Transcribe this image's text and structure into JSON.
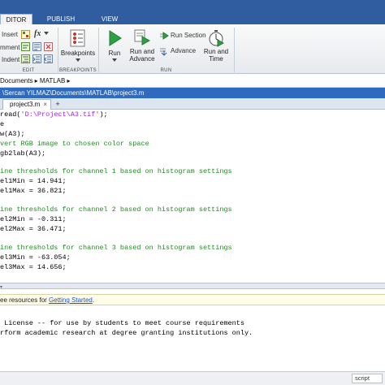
{
  "tabs": [
    {
      "label": "EDITOR",
      "active": true,
      "display": "DITOR"
    },
    {
      "label": "PUBLISH",
      "active": false,
      "display": "PUBLISH"
    },
    {
      "label": "VIEW",
      "active": false,
      "display": "VIEW"
    }
  ],
  "ribbon": {
    "edit_group": {
      "insert": "Insert",
      "fx": "fx",
      "comment": "mment",
      "indent": "Indent",
      "label": "EDIT"
    },
    "breakpoints_group": {
      "breakpoints": "Breakpoints",
      "label": "BREAKPOINTS"
    },
    "run_group": {
      "run": "Run",
      "run_advance": "Run and Advance",
      "run_section": "Run Section",
      "advance": "Advance",
      "run_time": "Run and Time",
      "label": "RUN"
    }
  },
  "address_bar": {
    "path": "Documents ▸ MATLAB ▸"
  },
  "editor": {
    "title": "\\Sercan YILMAZ\\Documents\\MATLAB\\project3.m",
    "file_tab": "project3.m",
    "close_glyph": "×",
    "plus_glyph": "+",
    "lines": [
      {
        "pre": "read(",
        "str": "'D:\\Project\\A3.tif'",
        "post": ");"
      },
      {
        "text": "e"
      },
      {
        "text": "w(A3);"
      },
      {
        "cmt": "vert RGB image to chosen color space"
      },
      {
        "text": "gb2lab(A3);"
      },
      {
        "text": ""
      },
      {
        "cmt": "ine thresholds for channel 1 based on histogram settings"
      },
      {
        "text": "el1Min = 14.941;"
      },
      {
        "text": "el1Max = 36.821;"
      },
      {
        "text": ""
      },
      {
        "cmt": "ine thresholds for channel 2 based on histogram settings"
      },
      {
        "text": "el2Min = -0.311;"
      },
      {
        "text": "el2Max = 36.471;"
      },
      {
        "text": ""
      },
      {
        "cmt": "ine thresholds for channel 3 based on histogram settings"
      },
      {
        "text": "el3Min = -63.054;"
      },
      {
        "text": "el3Max = 14.656;"
      }
    ]
  },
  "command_window": {
    "notice_prefix": "ee resources for ",
    "notice_link": "Getting Started",
    "notice_suffix": ".",
    "lines": [
      " License -- for use by students to meet course requirements",
      "rform academic research at degree granting institutions only."
    ]
  },
  "status": {
    "mode": "script"
  },
  "colors": {
    "title_bar": "#2f5da0",
    "editor_title": "#2e6ac0",
    "string": "#a020f0",
    "comment": "#228b22",
    "link": "#1a4fd6"
  }
}
